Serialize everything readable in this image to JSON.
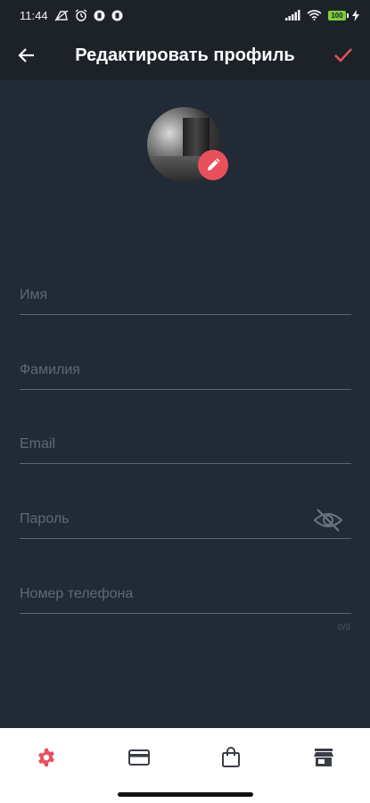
{
  "status_bar": {
    "time": "11:44",
    "battery_level": "100",
    "icons": [
      "no-sim-icon",
      "alarm-icon",
      "app-icon",
      "app-icon",
      "signal-icon",
      "wifi-icon",
      "battery-icon",
      "charging-icon"
    ]
  },
  "header": {
    "title": "Редактировать профиль",
    "back_icon": "arrow-left-icon",
    "confirm_icon": "check-icon"
  },
  "avatar": {
    "edit_icon": "pencil-icon"
  },
  "form": {
    "fields": [
      {
        "label": "Имя"
      },
      {
        "label": "Фамилия"
      },
      {
        "label": "Email"
      },
      {
        "label": "Пароль",
        "icon": "eye-off-icon"
      },
      {
        "label": "Номер телефона"
      }
    ],
    "phone_counter": "0/9"
  },
  "bottom_nav": {
    "items": [
      {
        "icon": "settings-icon",
        "active": true
      },
      {
        "icon": "credit-card-icon",
        "active": false
      },
      {
        "icon": "shopping-bag-icon",
        "active": false
      },
      {
        "icon": "store-icon",
        "active": false
      }
    ]
  },
  "colors": {
    "background": "#222a35",
    "app_bar": "#1d2229",
    "accent": "#e8505b",
    "placeholder": "#5f6874",
    "underline": "#5c6470"
  }
}
